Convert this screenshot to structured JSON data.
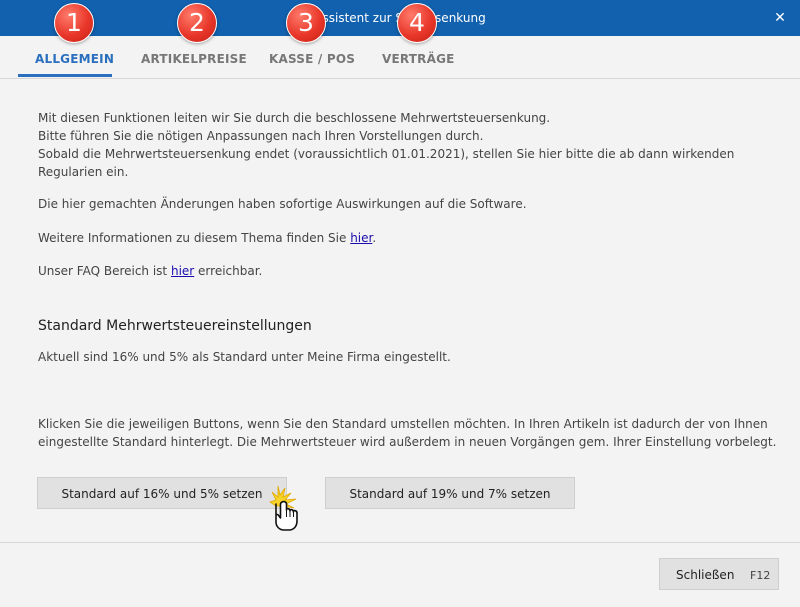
{
  "window": {
    "title": "Assistent zur Steuersenkung",
    "close_glyph": "✕"
  },
  "tabs": [
    {
      "label": "ALLGEMEIN",
      "active": true
    },
    {
      "label": "ARTIKELPREISE",
      "active": false
    },
    {
      "label": "KASSE / POS",
      "active": false
    },
    {
      "label": "VERTRÄGE",
      "active": false
    }
  ],
  "badges": [
    "1",
    "2",
    "3",
    "4"
  ],
  "intro": {
    "line1": "Mit diesen Funktionen leiten wir Sie durch die beschlossene Mehrwertsteuersenkung.",
    "line2": "Bitte führen Sie die nötigen Anpassungen nach Ihren Vorstellungen durch.",
    "line3": "Sobald die Mehrwertsteuersenkung endet (voraussichtlich 01.01.2021), stellen Sie hier bitte die ab dann wirkenden",
    "line4": "Regularien ein."
  },
  "notice": "Die hier gemachten Änderungen haben sofortige Auswirkungen auf die Software.",
  "info": {
    "prefix": "Weitere Informationen zu diesem Thema finden Sie ",
    "link": "hier",
    "suffix": "."
  },
  "faq": {
    "prefix": "Unser FAQ Bereich ist ",
    "link": "hier",
    "suffix": " erreichbar."
  },
  "section": {
    "heading": "Standard Mehrwertsteuereinstellungen",
    "current": "Aktuell sind 16% und 5% als Standard unter Meine Firma eingestellt."
  },
  "instructions": {
    "line1": "Klicken Sie die jeweiligen Buttons, wenn Sie den Standard umstellen möchten. In Ihren Artikeln ist dadurch der von Ihnen",
    "line2": "eingestellte Standard hinterlegt. Die Mehrwertsteuer wird außerdem in neuen Vorgängen gem. Ihrer Einstellung vorbelegt."
  },
  "buttons": {
    "set_16_5": "Standard auf 16% und 5% setzen",
    "set_19_7": "Standard auf 19% und 7% setzen"
  },
  "footer": {
    "close_label": "Schließen",
    "close_key": "F12"
  },
  "colors": {
    "titlebar": "#1161ae",
    "accent": "#2a6fbe",
    "badge": "#e8372a"
  }
}
